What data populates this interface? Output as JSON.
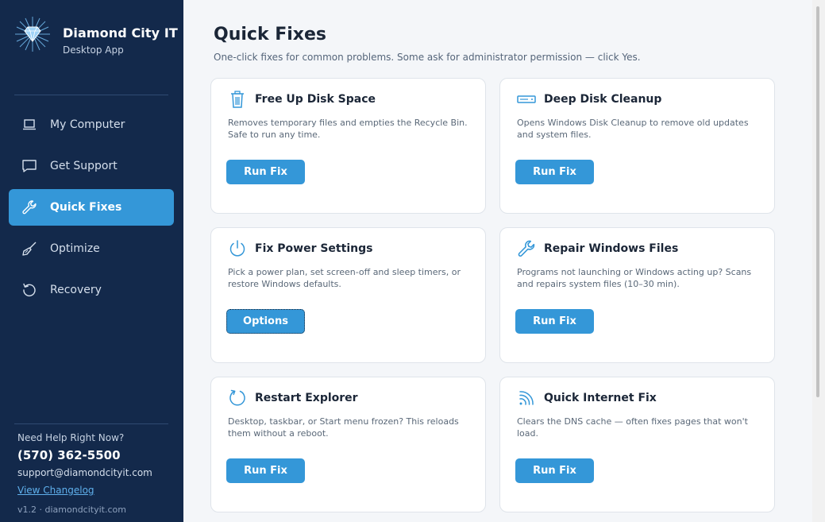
{
  "brand": {
    "title": "Diamond City IT",
    "subtitle": "Desktop App"
  },
  "nav": {
    "items": [
      {
        "label": "My Computer",
        "icon": "laptop-icon"
      },
      {
        "label": "Get Support",
        "icon": "chat-icon"
      },
      {
        "label": "Quick Fixes",
        "icon": "wrench-icon",
        "active": true
      },
      {
        "label": "Optimize",
        "icon": "broom-icon"
      },
      {
        "label": "Recovery",
        "icon": "restore-icon"
      }
    ]
  },
  "help": {
    "label": "Need Help Right Now?",
    "phone": "(570) 362-5500",
    "email": "support@diamondcityit.com",
    "changelog": "View Changelog",
    "footer": "v1.2  ·  diamondcityit.com"
  },
  "page": {
    "title": "Quick Fixes",
    "subtitle": "One-click fixes for common problems. Some ask for administrator permission — click Yes."
  },
  "cards": [
    {
      "title": "Free Up Disk Space",
      "icon": "trash-icon",
      "desc": "Removes temporary files and empties the Recycle Bin. Safe to run any time.",
      "button": "Run Fix"
    },
    {
      "title": "Deep Disk Cleanup",
      "icon": "drive-icon",
      "desc": "Opens Windows Disk Cleanup to remove old updates and system files.",
      "button": "Run Fix"
    },
    {
      "title": "Fix Power Settings",
      "icon": "power-icon",
      "desc": "Pick a power plan, set screen-off and sleep timers, or restore Windows defaults.",
      "button": "Options"
    },
    {
      "title": "Repair Windows Files",
      "icon": "wrench-icon",
      "desc": "Programs not launching or Windows acting up? Scans and repairs system files (10–30 min).",
      "button": "Run Fix"
    },
    {
      "title": "Restart Explorer",
      "icon": "refresh-icon",
      "desc": "Desktop, taskbar, or Start menu frozen? This reloads them without a reboot.",
      "button": "Run Fix"
    },
    {
      "title": "Quick Internet Fix",
      "icon": "wifi-icon",
      "desc": "Clears the DNS cache — often fixes pages that won't load.",
      "button": "Run Fix"
    }
  ],
  "colors": {
    "sidebar": "#13294b",
    "accent": "#3497d8",
    "background": "#f4f6f9"
  }
}
